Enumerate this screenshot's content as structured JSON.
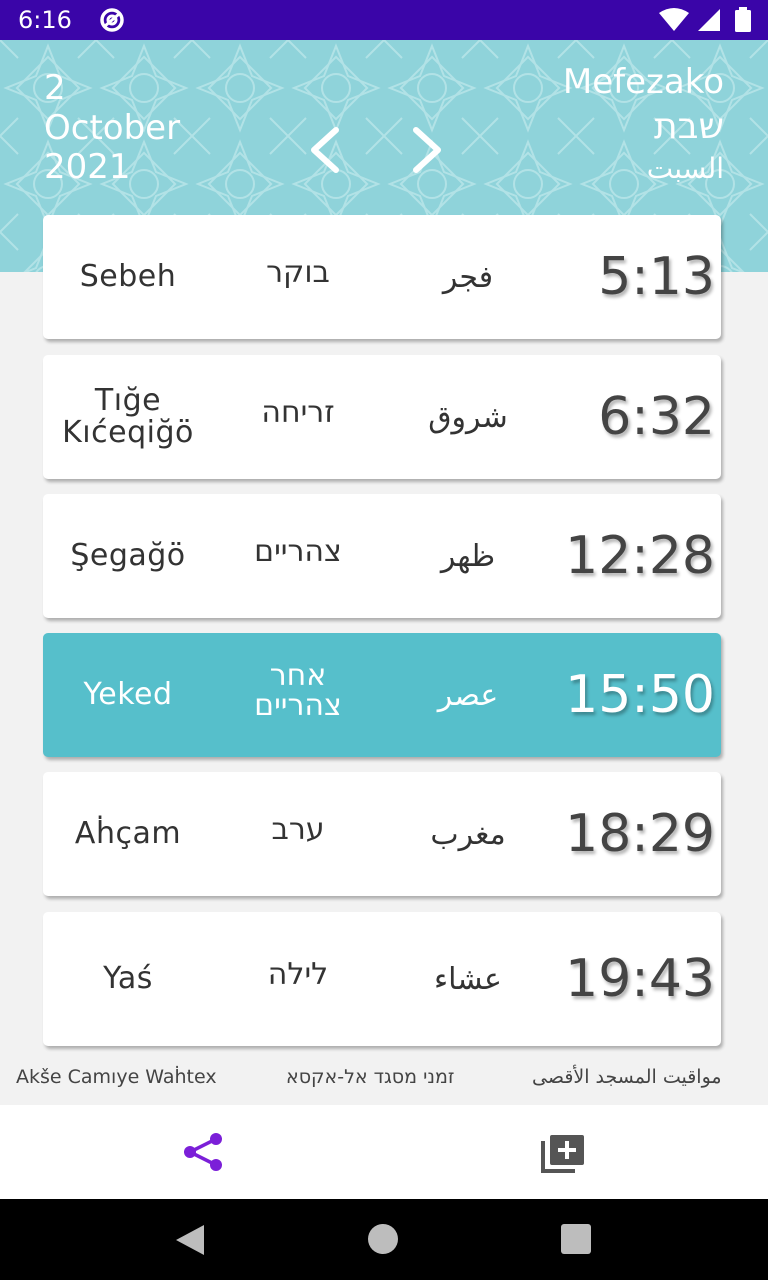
{
  "status_bar": {
    "time": "6:16"
  },
  "header": {
    "date_day": "2",
    "date_month": "October",
    "date_year": "2021",
    "day_latin": "Mefezako",
    "day_hebrew": "שבת",
    "day_arabic": "السبت"
  },
  "prayers": [
    {
      "latin": "Sebeh",
      "hebrew": "בוקר",
      "arabic": "فجر",
      "time": "5:13",
      "active": false
    },
    {
      "latin": "Tığe Kıćeqiğö",
      "hebrew": "זריחה",
      "arabic": "شروق",
      "time": "6:32",
      "active": false
    },
    {
      "latin": "Şegağö",
      "hebrew": "צהריים",
      "arabic": "ظهر",
      "time": "12:28",
      "active": false
    },
    {
      "latin": "Yeked",
      "hebrew": "אחר צהריים",
      "arabic": "عصر",
      "time": "15:50",
      "active": true
    },
    {
      "latin": "Aḣçam",
      "hebrew": "ערב",
      "arabic": "مغرب",
      "time": "18:29",
      "active": false
    },
    {
      "latin": "Yaś",
      "hebrew": "לילה",
      "arabic": "عشاء",
      "time": "19:43",
      "active": false
    }
  ],
  "credits": {
    "latin": "Akše Camıye Waḣtex",
    "hebrew": "זמני מסגד אל-אקסא",
    "arabic": "مواقيت المسجد الأقصى"
  },
  "icons": {
    "share": "share-icon",
    "add_library": "add-to-library-icon",
    "prev": "chevron-left-icon",
    "next": "chevron-right-icon"
  },
  "colors": {
    "status_bar": "#3a05a8",
    "header_bg": "#8fd3da",
    "active_card": "#56bfcb",
    "accent": "#7b1fd8"
  }
}
